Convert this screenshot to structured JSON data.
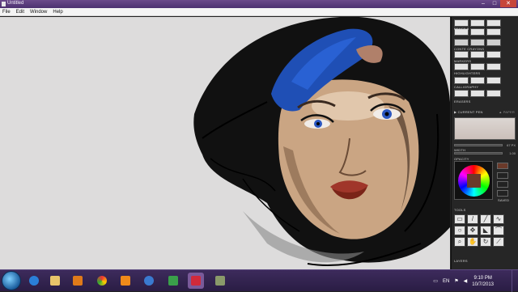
{
  "window": {
    "title": "Untitled",
    "minimize": "–",
    "maximize": "□",
    "close": "✕"
  },
  "menu": {
    "items": [
      "File",
      "Edit",
      "Window",
      "Help"
    ]
  },
  "panel": {
    "sections": {
      "pencils": "PENCILS",
      "conte": "CONTE CRAYONS",
      "markers": "MARKERS",
      "highlighters": "HIGHLIGHTERS",
      "calligraphy": "CALLIGRAPHY",
      "erasers": "ERASERS",
      "current_pen": "▶ CURRENT PEN",
      "paper": "▲ PAPER",
      "width": "WIDTH",
      "opacity": "OPACITY",
      "tools": "TOOLS",
      "layers": "LAYERS",
      "saved": "SAVED"
    },
    "width_value": "67 PX",
    "opacity_value": "1.00"
  },
  "taskbar": {
    "language": "EN",
    "time": "9:10 PM",
    "date": "10/7/2013"
  },
  "colors": {
    "accent": "#4c3170",
    "canvas": "#dddcdc",
    "panel": "#262626",
    "current_color": "#6b3a2a"
  }
}
